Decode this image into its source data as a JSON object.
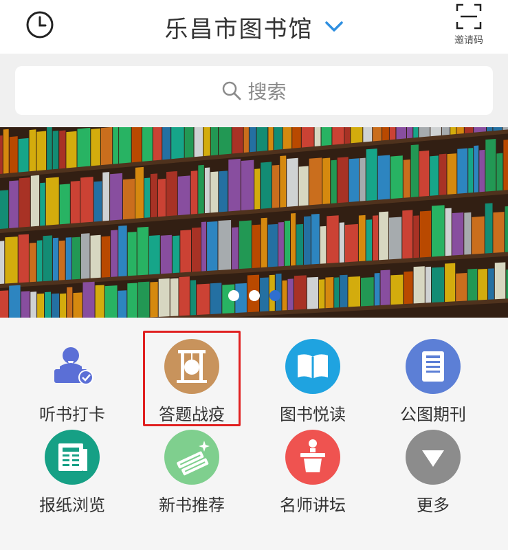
{
  "header": {
    "title": "乐昌市图书馆",
    "history_icon": "clock-icon",
    "dropdown_icon": "chevron-down-icon",
    "invite_label": "邀请码",
    "invite_icon": "scan-icon"
  },
  "search": {
    "placeholder": "搜索",
    "icon": "search-icon"
  },
  "banner": {
    "image": "bookshelf-photo",
    "dots": [
      {
        "active": false
      },
      {
        "active": false
      },
      {
        "active": true
      }
    ]
  },
  "grid": {
    "items": [
      {
        "label": "听书打卡",
        "icon": "listener-check-icon",
        "color": "#5b6fd6"
      },
      {
        "label": "答题战疫",
        "icon": "gong-icon",
        "color": "#c8935c",
        "highlighted": true
      },
      {
        "label": "图书悦读",
        "icon": "open-book-icon",
        "color": "#1fa3e0"
      },
      {
        "label": "公图期刊",
        "icon": "document-icon",
        "color": "#5c7fd6"
      },
      {
        "label": "报纸浏览",
        "icon": "newspaper-icon",
        "color": "#16a085"
      },
      {
        "label": "新书推荐",
        "icon": "new-books-icon",
        "color": "#7fcf8e"
      },
      {
        "label": "名师讲坛",
        "icon": "podium-icon",
        "color": "#ef5350"
      },
      {
        "label": "更多",
        "icon": "more-triangle-icon",
        "color": "#8c8c8c"
      }
    ]
  },
  "colors": {
    "accent": "#2f6fd0",
    "highlight_border": "#e02020"
  }
}
